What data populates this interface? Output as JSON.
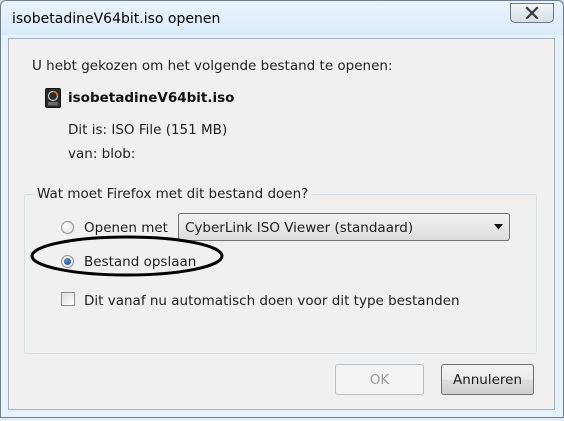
{
  "window": {
    "title": "isobetadineV64bit.iso openen",
    "close_icon": "close-icon"
  },
  "dialog": {
    "heading": "U hebt gekozen om het volgende bestand te openen:",
    "file": {
      "icon": "iso-file-icon",
      "name": "isobetadineV64bit.iso",
      "type_line": "Dit is:  ISO File (151 MB)",
      "source_line": "van:  blob:"
    },
    "action_group": {
      "legend": "Wat moet Firefox met dit bestand doen?",
      "open_with": {
        "label": "Openen met",
        "selected": false,
        "app_select_value": "CyberLink ISO Viewer (standaard)"
      },
      "save_file": {
        "label": "Bestand opslaan",
        "selected": true
      },
      "auto_checkbox": {
        "label": "Dit vanaf nu automatisch doen voor dit type bestanden",
        "checked": false
      }
    },
    "buttons": {
      "ok": "OK",
      "cancel": "Annuleren"
    }
  },
  "annotation": {
    "shape": "ellipse",
    "color": "#000000"
  },
  "colors": {
    "client_bg": "#f0f0f0",
    "frame_bg": "#e7f1fb",
    "radio_dot": "#0b3e86"
  }
}
